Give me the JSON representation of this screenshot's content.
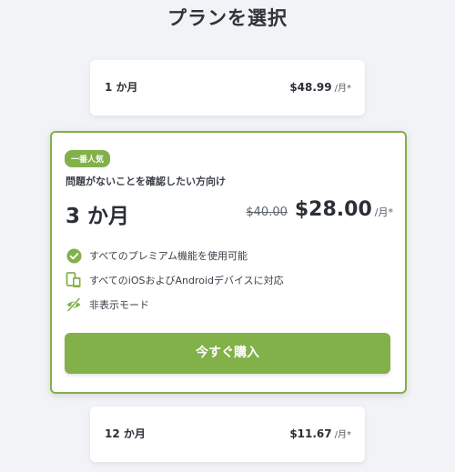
{
  "header": {
    "title": "プランを選択"
  },
  "plans": [
    {
      "name": "1 か月",
      "price": "$48.99",
      "unit": "/月*"
    },
    {
      "name": "12 か月",
      "price": "$11.67",
      "unit": "/月*"
    }
  ],
  "featured": {
    "badge": "一番人気",
    "subtitle": "問題がないことを確認したい方向け",
    "name": "3 か月",
    "old_price": "$40.00",
    "price": "$28.00",
    "unit": "/月*",
    "features": [
      {
        "icon": "check-circle-icon",
        "text": "すべてのプレミアム機能を使用可能"
      },
      {
        "icon": "devices-icon",
        "text": "すべてのiOSおよびAndroidデバイスに対応"
      },
      {
        "icon": "eye-off-icon",
        "text": "非表示モード"
      }
    ],
    "buy_label": "今すぐ購入"
  },
  "colors": {
    "accent": "#82b14a",
    "background": "#f2f3f6",
    "card": "#ffffff"
  }
}
